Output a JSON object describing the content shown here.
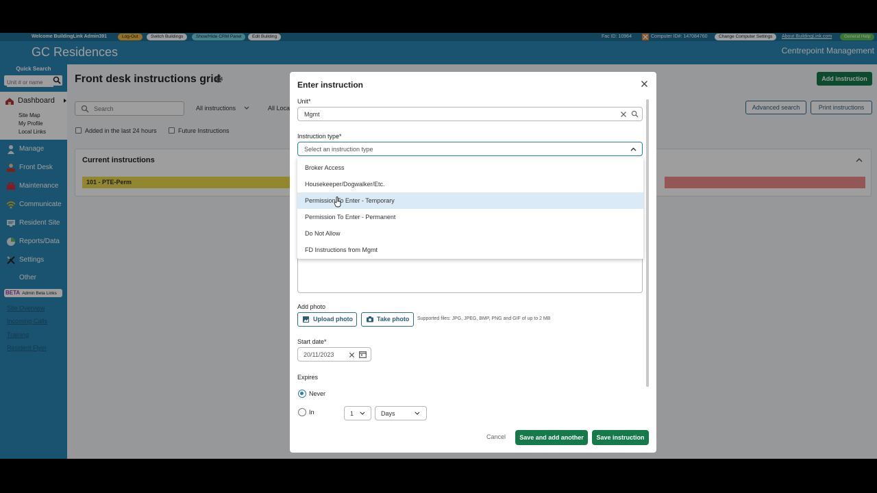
{
  "topbar": {
    "welcome": "Welcome  BuildingLink Admin391",
    "logout": "Log-Out",
    "switch_buildings": "Switch Buildings",
    "crm_panel": "Show/Hide CRM Panel",
    "edit_building": "Edit Building",
    "fac_id": "Fac ID:  10964",
    "computer_id": "Computer ID#:  147084760",
    "change_settings": "Change Computer Settings",
    "about": "About BuildingLink.com",
    "help": "General Help"
  },
  "header": {
    "site_name": "GC Residences",
    "company": "Centrepoint Management"
  },
  "sidebar": {
    "quick_search_label": "Quick Search",
    "quick_search_placeholder": "Unit # or name",
    "dashboard": "Dashboard",
    "dashboard_links": [
      "Site Map",
      "My Profile",
      "Local Links"
    ],
    "items": [
      {
        "label": "Manage",
        "icon": "people-icon",
        "color": "#d7e4ee"
      },
      {
        "label": "Front Desk",
        "icon": "desk-icon",
        "color": "#c0392b"
      },
      {
        "label": "Maintenance",
        "icon": "toolbox-icon",
        "color": "#d62c3a"
      },
      {
        "label": "Communicate",
        "icon": "wifi-icon",
        "color": "#f1c40f"
      },
      {
        "label": "Resident Site",
        "icon": "monitor-icon",
        "color": "#dde6ee"
      },
      {
        "label": "Reports/Data",
        "icon": "chart-icon",
        "color": "#5cb85c"
      },
      {
        "label": "Settings",
        "icon": "tools-icon",
        "color": "#c8d3dd"
      },
      {
        "label": "Other",
        "icon": "",
        "color": ""
      }
    ],
    "beta_tag": "BETA",
    "beta_label": "Admin Beta Links",
    "links": [
      "Site Overview",
      "Incoming Calls",
      "Training",
      "Resident Flyer"
    ]
  },
  "main": {
    "title": "Front desk instructions grid",
    "add_button": "Add instruction",
    "search_placeholder": "Search",
    "filter_all": "All instructions",
    "filter_loc": "All Loca",
    "advanced_search": "Advanced search",
    "print": "Print instructions",
    "check_24h": "Added in the last 24 hours",
    "check_future": "Future Instructions",
    "panel_title": "Current instructions",
    "row_label": "101 - PTE-Perm"
  },
  "modal": {
    "title": "Enter instruction",
    "unit_label": "Unit*",
    "unit_value": "Mgmt",
    "type_label": "Instruction type*",
    "type_placeholder": "Select an instruction type",
    "options": [
      "Broker Access",
      "Housekeeper/Dogwalker/Etc.",
      "Permission To Enter - Temporary",
      "Permission To Enter - Permanent",
      "Do Not Allow",
      "FD Instructions from Mgmt"
    ],
    "highlighted_option_index": 2,
    "add_photo_label": "Add photo",
    "upload_photo": "Upload photo",
    "take_photo": "Take photo",
    "supported_files": "Supported files: JPG, JPEG, BMP, PNG and GIF of up to 2 MB",
    "start_date_label": "Start date*",
    "start_date_value": "20/11/2023",
    "expires_label": "Expires",
    "never_label": "Never",
    "in_label": "In",
    "in_count": "1",
    "in_unit": "Days",
    "cancel": "Cancel",
    "save_add_another": "Save and add another",
    "save": "Save instruction"
  },
  "colors": {
    "accent_blue": "#2b86b3",
    "primary_green": "#147a4a",
    "highlight": "#dbeaf7"
  }
}
